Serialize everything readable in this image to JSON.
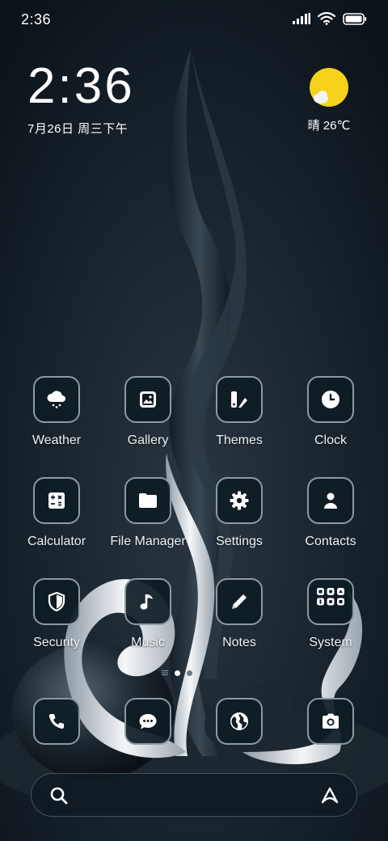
{
  "status_bar": {
    "time": "2:36",
    "icons": [
      "signal-icon",
      "wifi-icon",
      "battery-icon"
    ]
  },
  "clock_widget": {
    "time": "2:36",
    "date": "7月26日 周三下午"
  },
  "weather_widget": {
    "condition_icon": "sun-cloud-icon",
    "text": "晴 26℃"
  },
  "apps": [
    {
      "label": "Weather",
      "icon": "cloud-snow-icon"
    },
    {
      "label": "Gallery",
      "icon": "image-icon"
    },
    {
      "label": "Themes",
      "icon": "brush-icon"
    },
    {
      "label": "Clock",
      "icon": "clock-icon"
    },
    {
      "label": "Calculator",
      "icon": "calculator-icon"
    },
    {
      "label": "File Manager",
      "icon": "folder-icon"
    },
    {
      "label": "Settings",
      "icon": "gear-icon"
    },
    {
      "label": "Contacts",
      "icon": "person-icon"
    },
    {
      "label": "Security",
      "icon": "shield-icon"
    },
    {
      "label": "Music",
      "icon": "music-note-icon"
    },
    {
      "label": "Notes",
      "icon": "pencil-icon"
    },
    {
      "label": "System",
      "icon": "folder-grid-icon"
    }
  ],
  "page_indicator": {
    "pages": 2,
    "current": 1
  },
  "dock": [
    {
      "icon": "phone-icon"
    },
    {
      "icon": "message-icon"
    },
    {
      "icon": "globe-icon"
    },
    {
      "icon": "camera-icon"
    }
  ],
  "search": {
    "search_icon": "search-icon",
    "assistant_icon": "assistant-icon"
  },
  "colors": {
    "sun": "#f7d21c",
    "icon_border": "#8c9aa3",
    "icon_bg": "#0e1c24"
  }
}
